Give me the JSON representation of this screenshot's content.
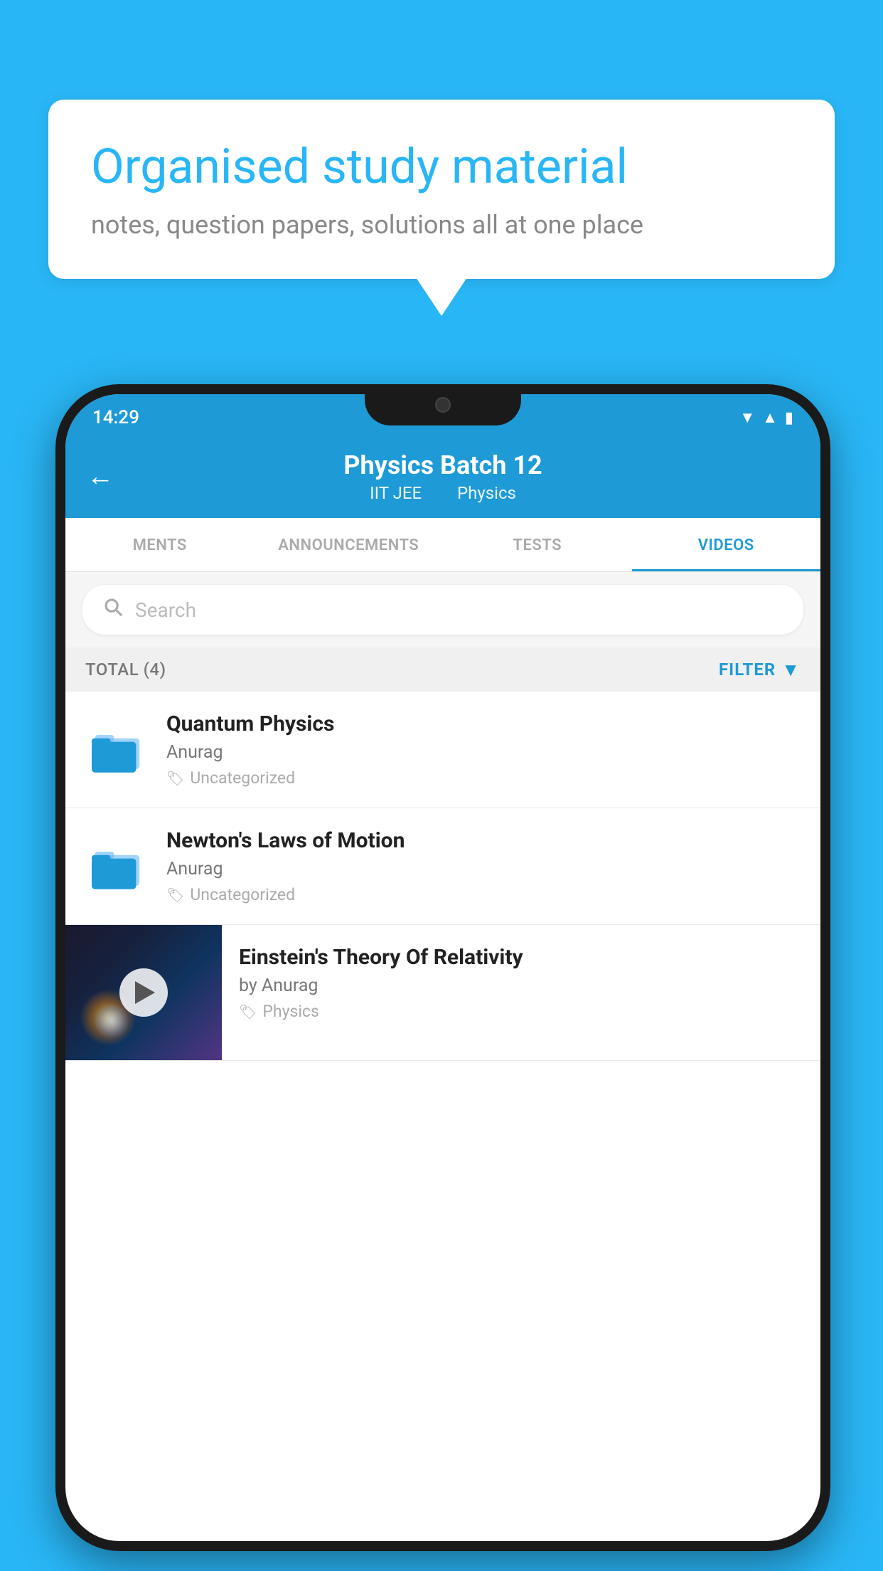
{
  "background_color": "#29B6F6",
  "speech_bubble": {
    "title": "Organised study material",
    "subtitle": "notes, question papers, solutions all at one place"
  },
  "phone": {
    "status_bar": {
      "time": "14:29",
      "icons": [
        "wifi",
        "signal",
        "battery"
      ]
    },
    "header": {
      "back_label": "←",
      "title": "Physics Batch 12",
      "subtitle_left": "IIT JEE",
      "subtitle_right": "Physics"
    },
    "tabs": [
      {
        "label": "MENTS",
        "active": false
      },
      {
        "label": "ANNOUNCEMENTS",
        "active": false
      },
      {
        "label": "TESTS",
        "active": false
      },
      {
        "label": "VIDEOS",
        "active": true
      }
    ],
    "search": {
      "placeholder": "Search"
    },
    "filter_bar": {
      "total_label": "TOTAL (4)",
      "filter_label": "FILTER"
    },
    "videos": [
      {
        "id": 1,
        "title": "Quantum Physics",
        "author": "Anurag",
        "tag": "Uncategorized",
        "has_thumbnail": false
      },
      {
        "id": 2,
        "title": "Newton's Laws of Motion",
        "author": "Anurag",
        "tag": "Uncategorized",
        "has_thumbnail": false
      },
      {
        "id": 3,
        "title": "Einstein's Theory Of Relativity",
        "author": "by Anurag",
        "tag": "Physics",
        "has_thumbnail": true
      }
    ]
  }
}
